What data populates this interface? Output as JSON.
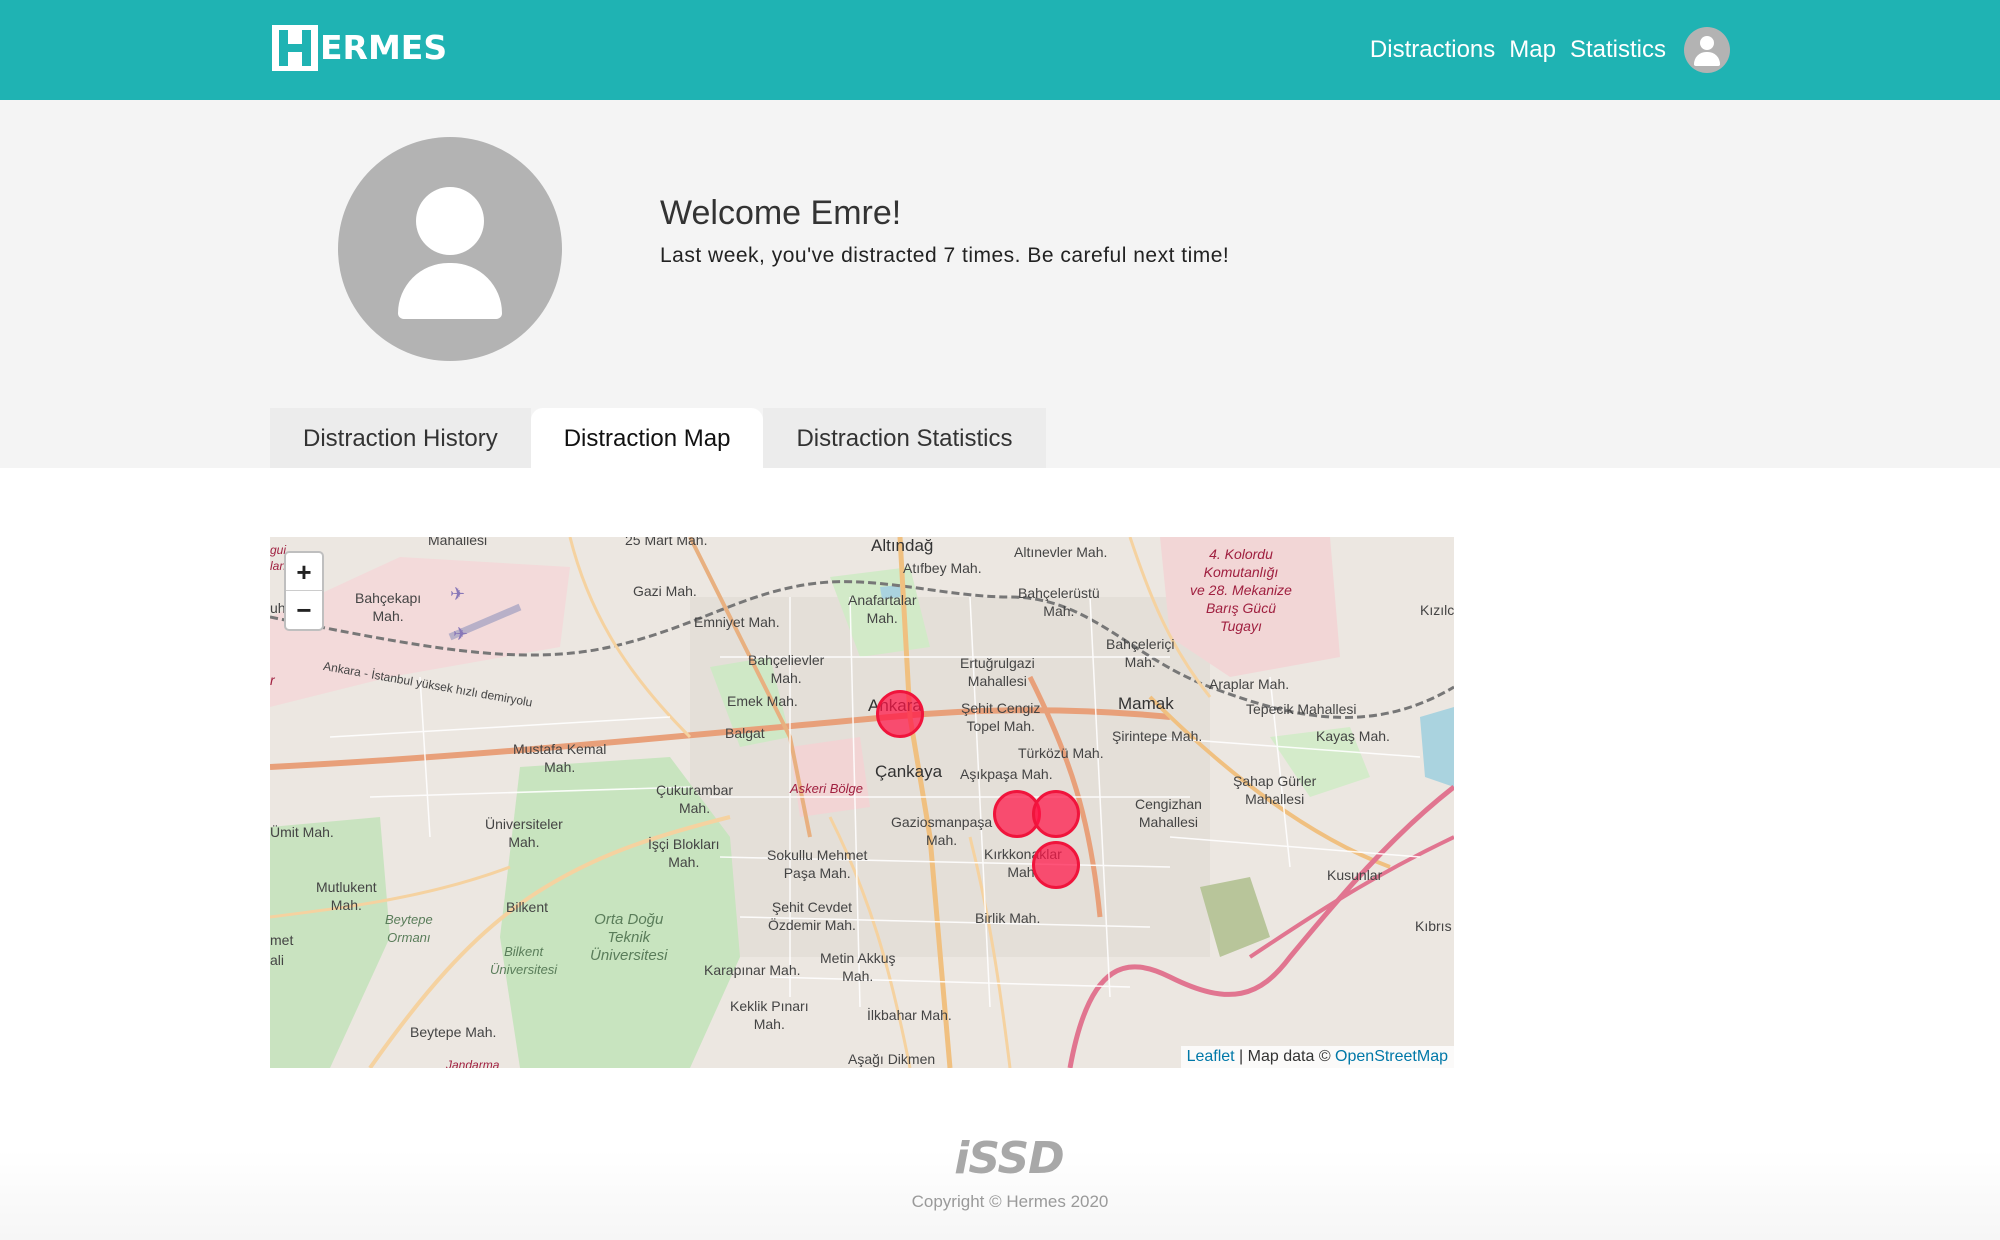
{
  "navbar": {
    "logo_text": "ERMES",
    "links": [
      "Distractions",
      "Map",
      "Statistics"
    ]
  },
  "profile": {
    "welcome": "Welcome Emre!",
    "subtext": "Last week, you've distracted 7 times. Be careful next time!"
  },
  "tabs": [
    {
      "label": "Distraction History",
      "active": false
    },
    {
      "label": "Distraction Map",
      "active": true
    },
    {
      "label": "Distraction Statistics",
      "active": false
    }
  ],
  "map": {
    "zoom_in": "+",
    "zoom_out": "−",
    "labels": {
      "altindag": "Altındağ",
      "atifbey": "Atıfbey Mah.",
      "altinevler": "Altınevler Mah.",
      "mart25": "25 Mart Mah.",
      "mahallesi_top": "Mahallesi",
      "gazi": "Gazi Mah.",
      "anafartalar": "Anafartalar\nMah.",
      "bahcelerustu": "Bahçelerüstü\nMah.",
      "kolordu": "4. Kolordu\nKomutanlığı\nve 28. Mekanize\nBarış Gücü\nTugayı",
      "kizil": "Kızılc",
      "bahcekapi": "Bahçekapı\nMah.",
      "emniyet": "Emniyet Mah.",
      "bahceleriici": "Bahçeleriçi\nMah.",
      "ertugrulgazi": "Ertuğrulgazi\nMahallesi",
      "bahcelievler": "Bahçelievler\nMah.",
      "araplar": "Araplar Mah.",
      "emek": "Emek Mah.",
      "ankara": "Ankara",
      "sehitcengiz": "Şehit Cengiz\nTopel Mah.",
      "mamak": "Mamak",
      "tepecik": "Tepecik Mahallesi",
      "balgat": "Balgat",
      "sirintepe": "Şirintepe Mah.",
      "kayas": "Kayaş Mah.",
      "mustafakemal": "Mustafa Kemal\nMah.",
      "turkozu": "Türközü Mah.",
      "cankaya": "Çankaya",
      "asikpasa": "Aşıkpaşa Mah.",
      "sahap": "Şahap Gürler\nMahallesi",
      "cukurambar": "Çukurambar\nMah.",
      "askeri": "Askeri Bölge",
      "gaziosmanpasa": "Gaziosmanpaşa\nMah.",
      "cengizhan": "Cengizhan\nMahallesi",
      "umit": "Ümit Mah.",
      "universiteler": "Üniversiteler\nMah.",
      "isci": "İşçi Blokları\nMah.",
      "sokullu": "Sokullu Mehmet\nPaşa Mah.",
      "kirkkonaklar": "Kırkkonaklar\nMah.",
      "kusunlar": "Kusunlar",
      "mutlukent": "Mutlukent\nMah.",
      "bilkent": "Bilkent",
      "sehitcevdet": "Şehit Cevdet\nÖzdemir Mah.",
      "birlik": "Birlik Mah.",
      "kibris": "Kıbrıs",
      "beytepe_ormani": "Beytepe\nOrmanı",
      "odtu": "Orta Doğu\nTeknik\nÜniversitesi",
      "bilkent_uni": "Bilkent\nÜniversitesi",
      "met": "met",
      "metinakkus": "Metin Akkuş\nMah.",
      "karapinar": "Karapınar Mah.",
      "ali": "ali",
      "keklik": "Keklik Pınarı\nMah.",
      "ilkbahar": "İlkbahar Mah.",
      "beytepe": "Beytepe Mah.",
      "asagidikmen": "Aşağı Dikmen",
      "jandarma": "Jandarma",
      "railway": "Ankara - İstanbul yüksek hızlı demiryolu",
      "gui": "gui",
      "lan": "lan",
      "uh": "uh.",
      "r": "r"
    },
    "markers_count_visible": 4,
    "attribution": {
      "leaflet": "Leaflet",
      "sep": " | Map data © ",
      "osm": "OpenStreetMap"
    },
    "colors": {
      "marker_fill": "#ff1446",
      "water": "#aad3df",
      "park": "#c8e6c0",
      "road_major": "#e8a07a",
      "military": "#f0d0d0"
    }
  },
  "footer": {
    "logo": "iSSD",
    "copyright": "Copyright © Hermes 2020"
  }
}
